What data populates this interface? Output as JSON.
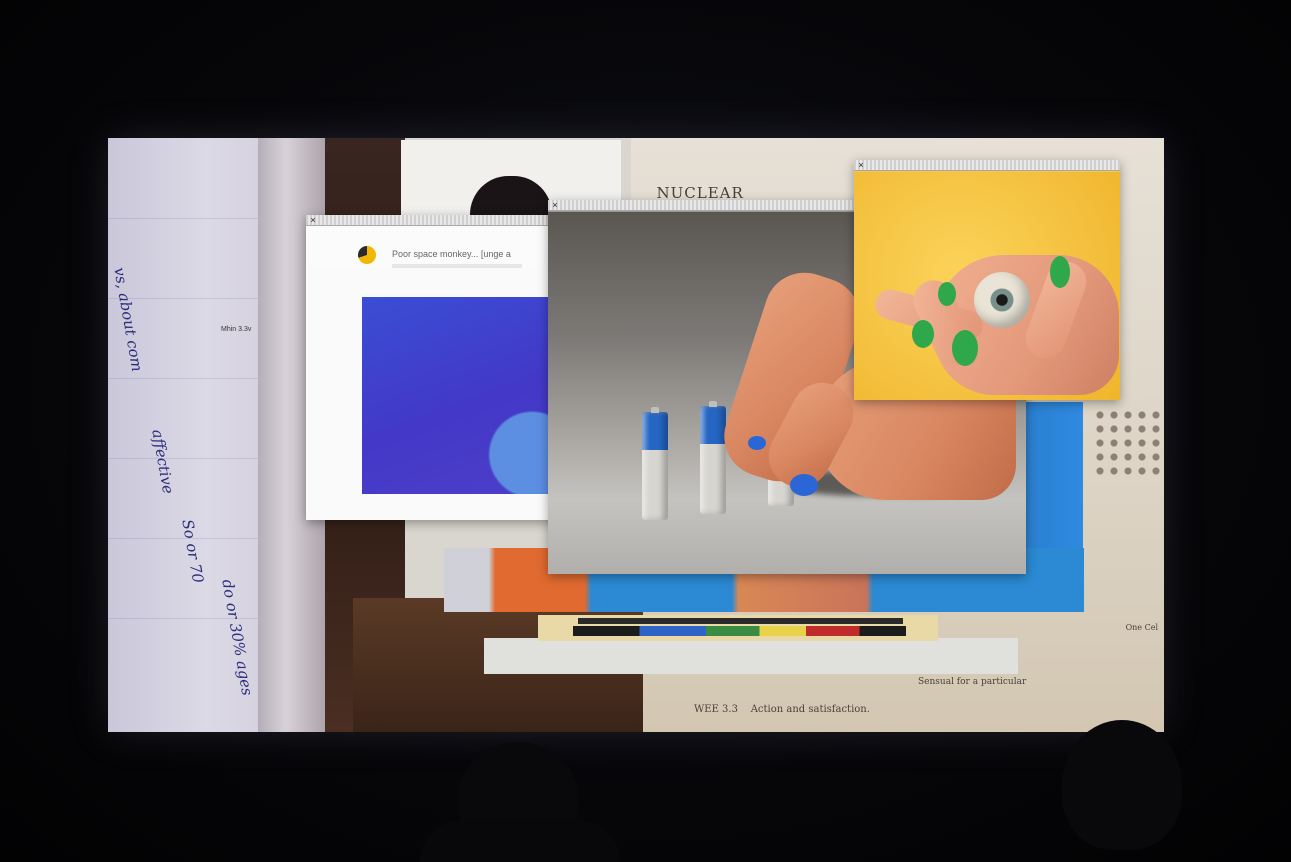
{
  "scene": {
    "description_visible_texts": {
      "doc_title": "_NUCLEAR",
      "doc_footer": "Action and satisfaction.",
      "doc_footer_section": "WEE 3.3",
      "doc_caption": "Sensual for a particular",
      "left_label": "Mhin 3.3v",
      "right_label": "One Cel"
    },
    "handwritten_notes": [
      "vs, about com",
      "affective",
      "So or 70",
      "do or 30% ages"
    ]
  },
  "windows": {
    "monkey": {
      "close_label": "×",
      "tab_title": "Poor space monkey... [unge a",
      "icon": "app-logo-icon"
    },
    "batteries": {
      "close_label": "×"
    },
    "eye": {
      "close_label": "×"
    }
  },
  "colors": {
    "screen_bg": "#d9d6cf",
    "blue_image": "#4338c8",
    "eye_bg": "#f6c54a",
    "battery_blue": "#2566c3",
    "nail_green": "#2fa84b"
  }
}
